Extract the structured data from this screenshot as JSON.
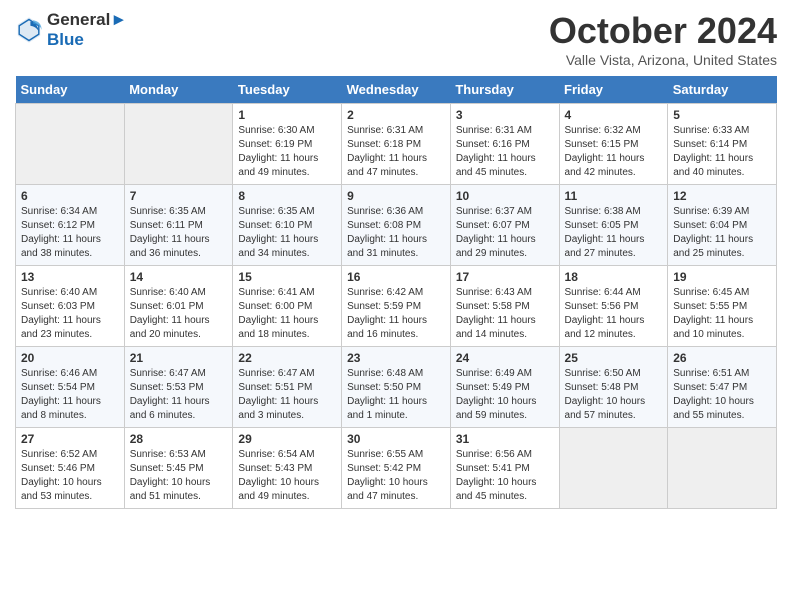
{
  "header": {
    "logo_line1": "General",
    "logo_line2": "Blue",
    "month": "October 2024",
    "location": "Valle Vista, Arizona, United States"
  },
  "days_of_week": [
    "Sunday",
    "Monday",
    "Tuesday",
    "Wednesday",
    "Thursday",
    "Friday",
    "Saturday"
  ],
  "weeks": [
    [
      {
        "day": "",
        "empty": true
      },
      {
        "day": "",
        "empty": true
      },
      {
        "day": "1",
        "sunrise": "6:30 AM",
        "sunset": "6:19 PM",
        "daylight": "11 hours and 49 minutes."
      },
      {
        "day": "2",
        "sunrise": "6:31 AM",
        "sunset": "6:18 PM",
        "daylight": "11 hours and 47 minutes."
      },
      {
        "day": "3",
        "sunrise": "6:31 AM",
        "sunset": "6:16 PM",
        "daylight": "11 hours and 45 minutes."
      },
      {
        "day": "4",
        "sunrise": "6:32 AM",
        "sunset": "6:15 PM",
        "daylight": "11 hours and 42 minutes."
      },
      {
        "day": "5",
        "sunrise": "6:33 AM",
        "sunset": "6:14 PM",
        "daylight": "11 hours and 40 minutes."
      }
    ],
    [
      {
        "day": "6",
        "sunrise": "6:34 AM",
        "sunset": "6:12 PM",
        "daylight": "11 hours and 38 minutes."
      },
      {
        "day": "7",
        "sunrise": "6:35 AM",
        "sunset": "6:11 PM",
        "daylight": "11 hours and 36 minutes."
      },
      {
        "day": "8",
        "sunrise": "6:35 AM",
        "sunset": "6:10 PM",
        "daylight": "11 hours and 34 minutes."
      },
      {
        "day": "9",
        "sunrise": "6:36 AM",
        "sunset": "6:08 PM",
        "daylight": "11 hours and 31 minutes."
      },
      {
        "day": "10",
        "sunrise": "6:37 AM",
        "sunset": "6:07 PM",
        "daylight": "11 hours and 29 minutes."
      },
      {
        "day": "11",
        "sunrise": "6:38 AM",
        "sunset": "6:05 PM",
        "daylight": "11 hours and 27 minutes."
      },
      {
        "day": "12",
        "sunrise": "6:39 AM",
        "sunset": "6:04 PM",
        "daylight": "11 hours and 25 minutes."
      }
    ],
    [
      {
        "day": "13",
        "sunrise": "6:40 AM",
        "sunset": "6:03 PM",
        "daylight": "11 hours and 23 minutes."
      },
      {
        "day": "14",
        "sunrise": "6:40 AM",
        "sunset": "6:01 PM",
        "daylight": "11 hours and 20 minutes."
      },
      {
        "day": "15",
        "sunrise": "6:41 AM",
        "sunset": "6:00 PM",
        "daylight": "11 hours and 18 minutes."
      },
      {
        "day": "16",
        "sunrise": "6:42 AM",
        "sunset": "5:59 PM",
        "daylight": "11 hours and 16 minutes."
      },
      {
        "day": "17",
        "sunrise": "6:43 AM",
        "sunset": "5:58 PM",
        "daylight": "11 hours and 14 minutes."
      },
      {
        "day": "18",
        "sunrise": "6:44 AM",
        "sunset": "5:56 PM",
        "daylight": "11 hours and 12 minutes."
      },
      {
        "day": "19",
        "sunrise": "6:45 AM",
        "sunset": "5:55 PM",
        "daylight": "11 hours and 10 minutes."
      }
    ],
    [
      {
        "day": "20",
        "sunrise": "6:46 AM",
        "sunset": "5:54 PM",
        "daylight": "11 hours and 8 minutes."
      },
      {
        "day": "21",
        "sunrise": "6:47 AM",
        "sunset": "5:53 PM",
        "daylight": "11 hours and 6 minutes."
      },
      {
        "day": "22",
        "sunrise": "6:47 AM",
        "sunset": "5:51 PM",
        "daylight": "11 hours and 3 minutes."
      },
      {
        "day": "23",
        "sunrise": "6:48 AM",
        "sunset": "5:50 PM",
        "daylight": "11 hours and 1 minute."
      },
      {
        "day": "24",
        "sunrise": "6:49 AM",
        "sunset": "5:49 PM",
        "daylight": "10 hours and 59 minutes."
      },
      {
        "day": "25",
        "sunrise": "6:50 AM",
        "sunset": "5:48 PM",
        "daylight": "10 hours and 57 minutes."
      },
      {
        "day": "26",
        "sunrise": "6:51 AM",
        "sunset": "5:47 PM",
        "daylight": "10 hours and 55 minutes."
      }
    ],
    [
      {
        "day": "27",
        "sunrise": "6:52 AM",
        "sunset": "5:46 PM",
        "daylight": "10 hours and 53 minutes."
      },
      {
        "day": "28",
        "sunrise": "6:53 AM",
        "sunset": "5:45 PM",
        "daylight": "10 hours and 51 minutes."
      },
      {
        "day": "29",
        "sunrise": "6:54 AM",
        "sunset": "5:43 PM",
        "daylight": "10 hours and 49 minutes."
      },
      {
        "day": "30",
        "sunrise": "6:55 AM",
        "sunset": "5:42 PM",
        "daylight": "10 hours and 47 minutes."
      },
      {
        "day": "31",
        "sunrise": "6:56 AM",
        "sunset": "5:41 PM",
        "daylight": "10 hours and 45 minutes."
      },
      {
        "day": "",
        "empty": true
      },
      {
        "day": "",
        "empty": true
      }
    ]
  ],
  "labels": {
    "sunrise": "Sunrise:",
    "sunset": "Sunset:",
    "daylight": "Daylight:"
  }
}
